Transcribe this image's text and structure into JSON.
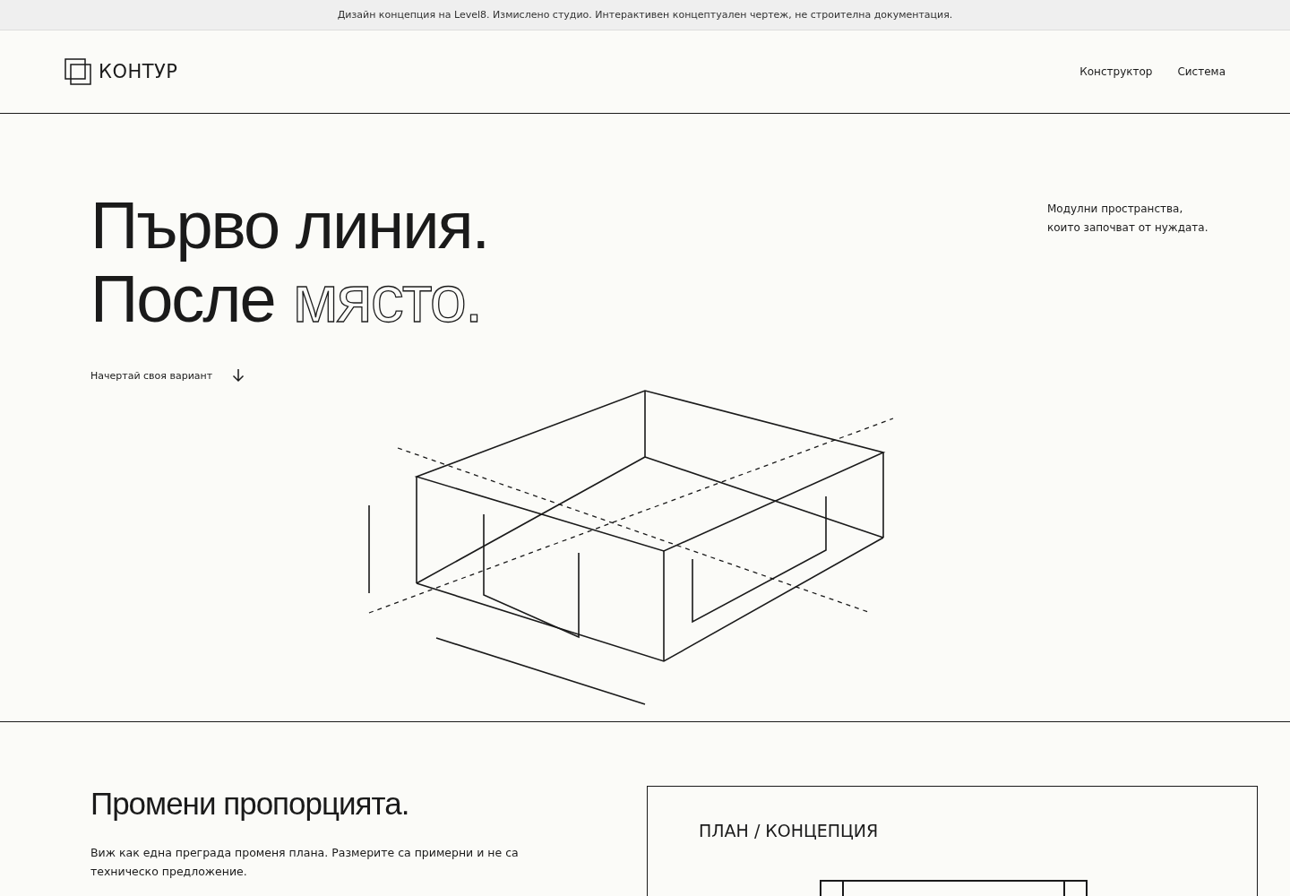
{
  "notice": "Дизайн концепция на Level8. Измислено студио. Интерактивен концептуален чертеж, не строителна документация.",
  "brand": "КОНТУР",
  "nav": [
    {
      "label": "Конструктор"
    },
    {
      "label": "Система"
    }
  ],
  "hero": {
    "line_1": "Първо линия.",
    "line_2": "После",
    "line_2_outlined": "място.",
    "tagline": "Модулни пространства,\nкоито започват от нуждата.",
    "cta": "Начертай своя вариант"
  },
  "section": {
    "heading": "Промени пропорцията.",
    "text": "Виж как една преграда променя плана. Размерите са примерни и не са техническо предложение.",
    "plan_title": "ПЛАН / КОНЦЕПЦИЯ"
  }
}
